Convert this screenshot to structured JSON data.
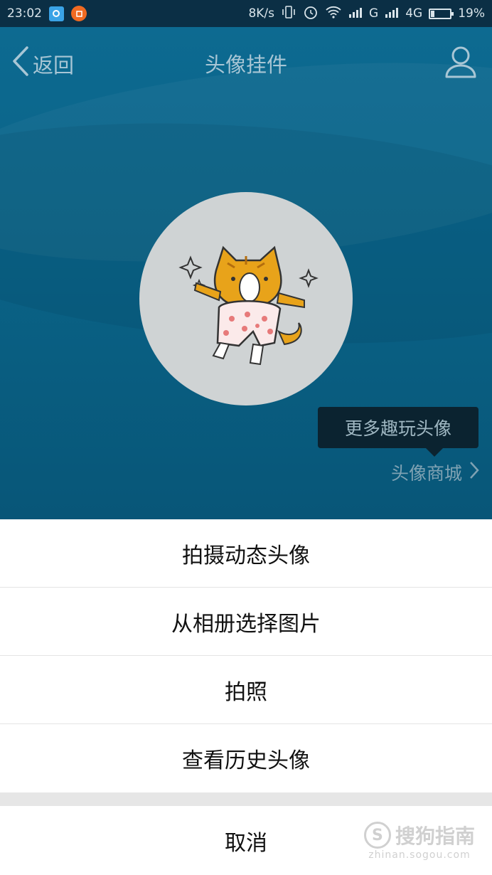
{
  "status_bar": {
    "time": "23:02",
    "net_speed": "8K/s",
    "signal_g": "G",
    "signal_4g": "4G",
    "battery": "19%",
    "battery_level": 0.19
  },
  "nav": {
    "back_label": "返回",
    "title": "头像挂件"
  },
  "tooltip": "更多趣玩头像",
  "shop_link": "头像商城",
  "sheet": {
    "options": [
      "拍摄动态头像",
      "从相册选择图片",
      "拍照",
      "查看历史头像"
    ],
    "cancel": "取消"
  },
  "watermark": {
    "logo_text": "S",
    "brand": "搜狗指南",
    "url": "zhinan.sogou.com"
  },
  "colors": {
    "status_bar": "#0b2f45",
    "header_blue": "#0a6488",
    "tooltip_bg": "#0b2330",
    "sheet_bg": "#ffffff"
  }
}
